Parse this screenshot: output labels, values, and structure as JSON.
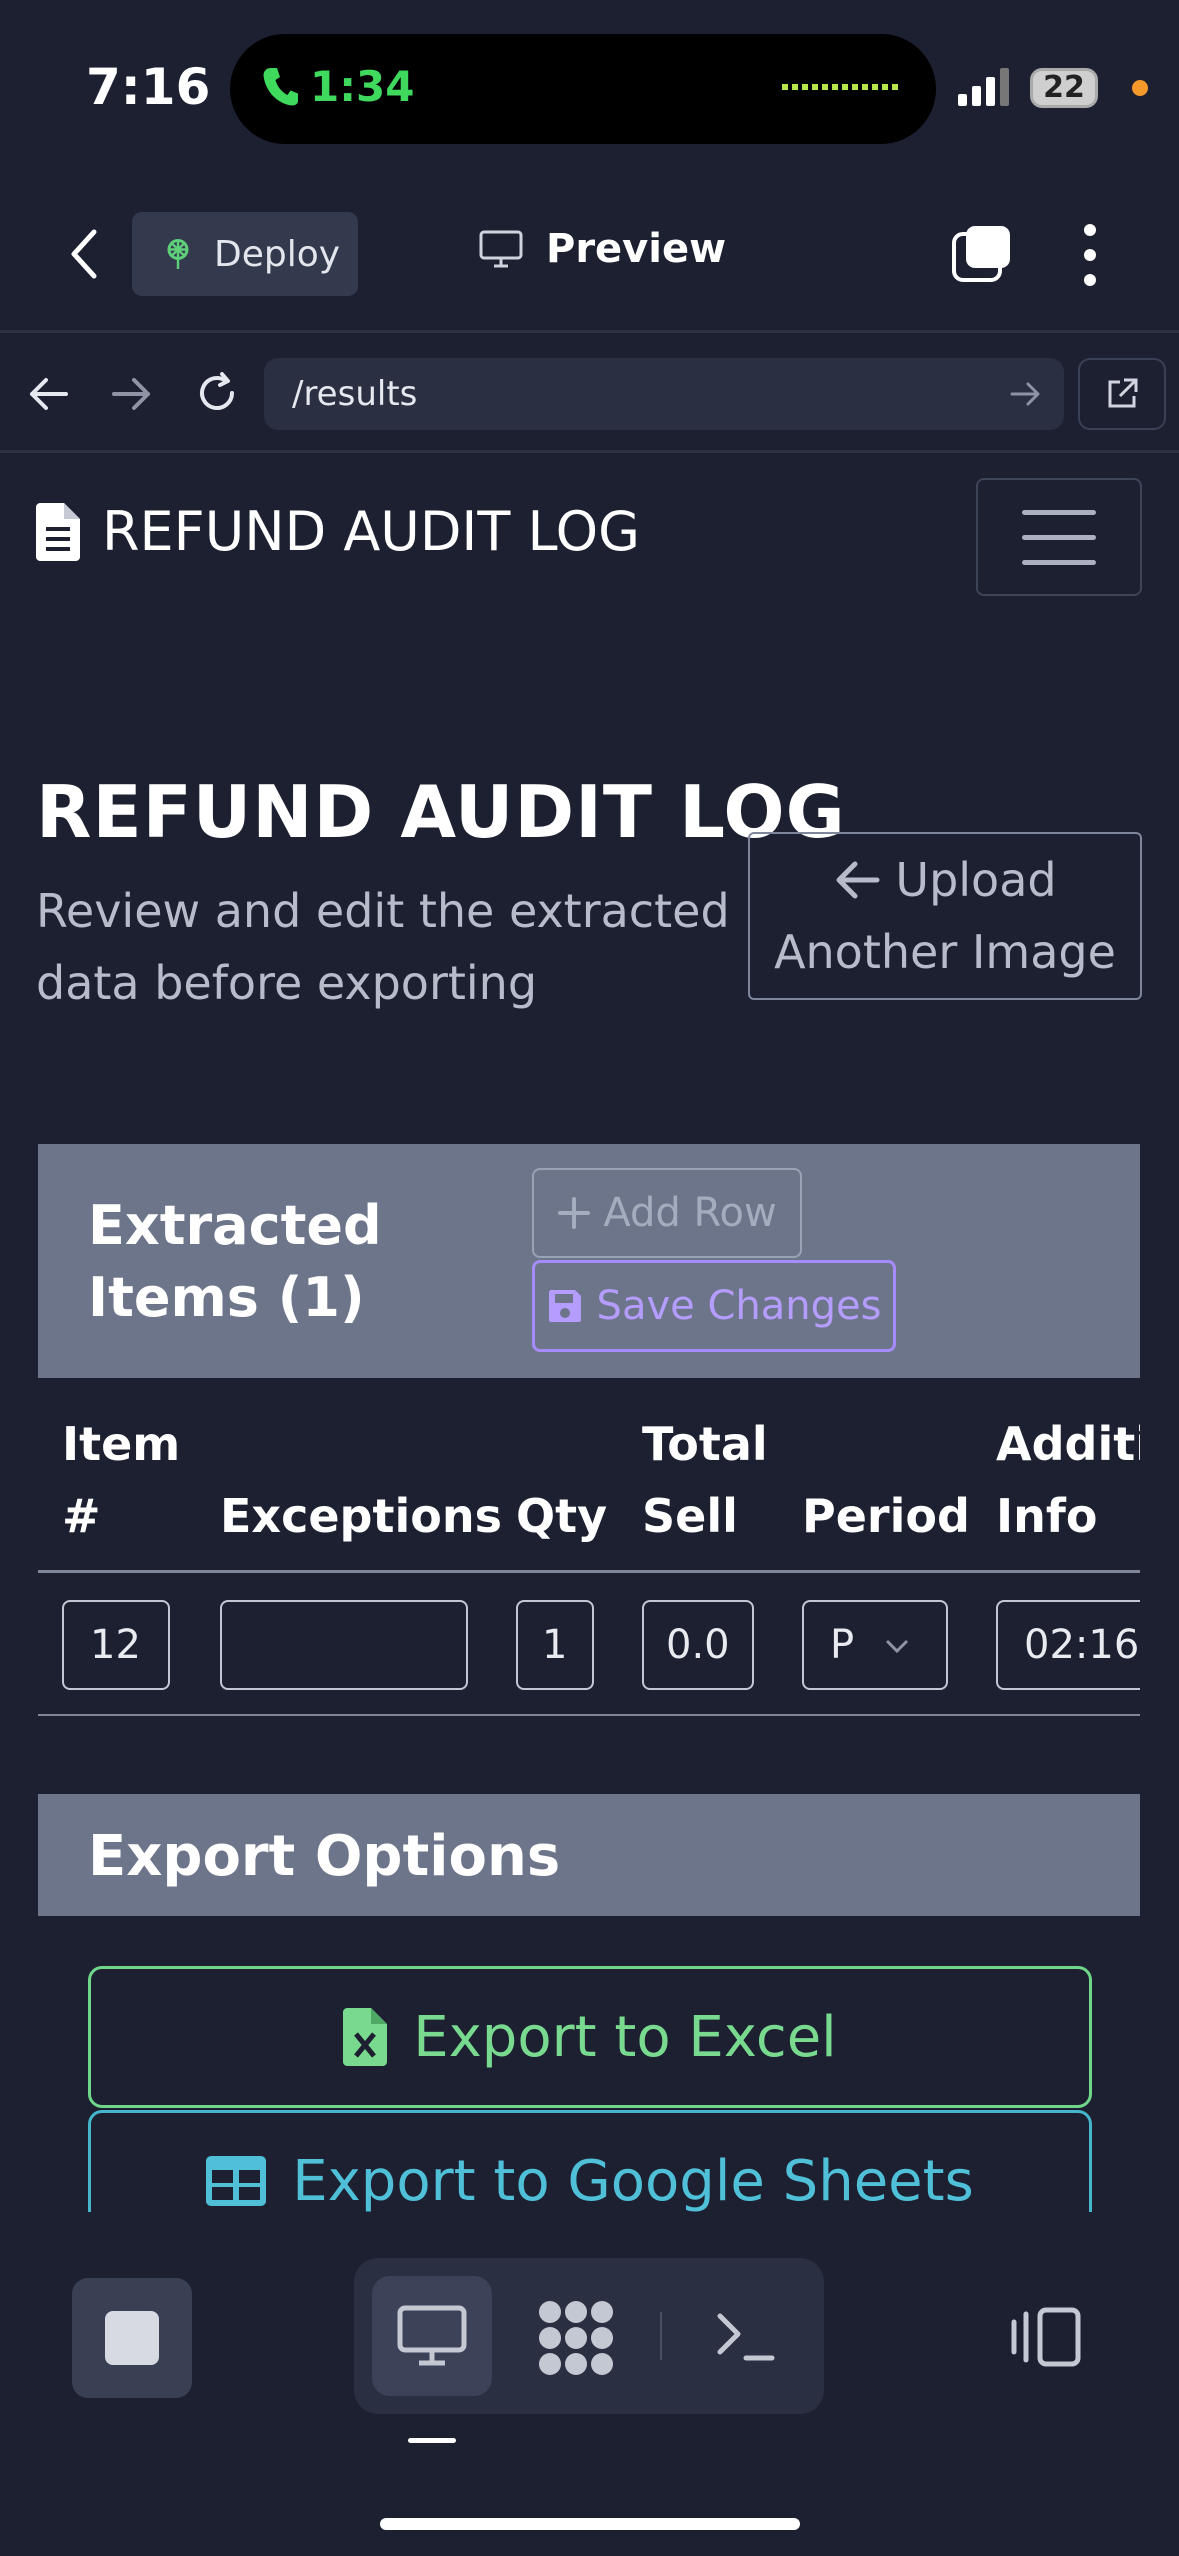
{
  "status_bar": {
    "time": "7:16",
    "call_time": "1:34",
    "battery": "22"
  },
  "app_bar": {
    "deploy_label": "Deploy",
    "preview_label": "Preview"
  },
  "browser": {
    "url": "/results"
  },
  "navbar": {
    "brand": "REFUND AUDIT LOG"
  },
  "page": {
    "title": "REFUND AUDIT LOG",
    "subtitle": "Review and edit the extracted data before exporting",
    "upload_button": "Upload Another Image"
  },
  "items_card": {
    "title": "Extracted Items (1)",
    "add_row": "Add Row",
    "save_changes": "Save Changes",
    "columns": [
      "Item #",
      "Exceptions",
      "Qty",
      "Total Sell",
      "Period",
      "Additi Info"
    ],
    "row": {
      "item": "12",
      "exceptions": "",
      "qty": "1",
      "total_sell": "0.0",
      "period": "P",
      "info": "02:16"
    }
  },
  "export_card": {
    "title": "Export Options",
    "excel_label": "Export to Excel",
    "sheets_label": "Export to Google Sheets"
  },
  "colors": {
    "accent_purple": "#a78bfa",
    "excel_green": "#78d98f",
    "sheets_cyan": "#4fc0d8",
    "background": "#1c2030"
  }
}
